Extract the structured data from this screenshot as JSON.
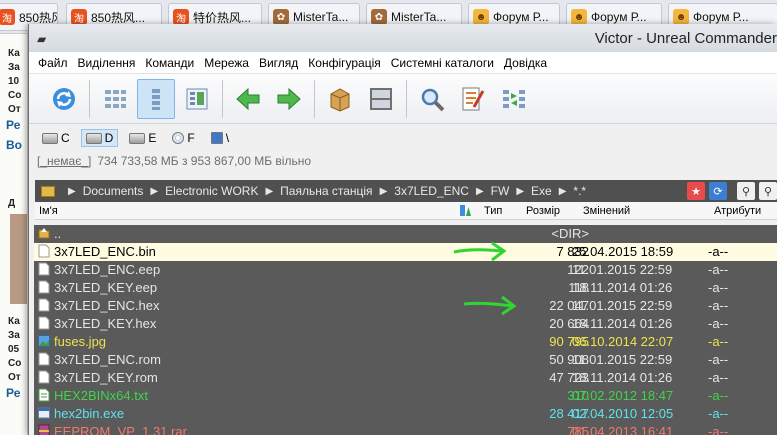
{
  "browser_tabs": [
    {
      "label": "850热风...",
      "icon": "taobao-icon"
    },
    {
      "label": "850热风...",
      "icon": "taobao-icon"
    },
    {
      "label": "特价热风...",
      "icon": "taobao-icon"
    },
    {
      "label": "MisterTa...",
      "icon": "paw-icon"
    },
    {
      "label": "MisterTa...",
      "icon": "paw-icon"
    },
    {
      "label": "Форум Р...",
      "icon": "cat-icon"
    },
    {
      "label": "Форум Р...",
      "icon": "cat-icon"
    },
    {
      "label": "Форум Р...",
      "icon": "cat-icon"
    }
  ],
  "background_page": {
    "fragments": [
      "Ка",
      "За",
      "10",
      "Со",
      "От",
      "Ре",
      "Во",
      "Д",
      "Ка",
      "За",
      "05",
      "Со",
      "От",
      "Ре"
    ]
  },
  "window": {
    "title": "Victor - Unreal Commander"
  },
  "menu": [
    "Файл",
    "Виділення",
    "Команди",
    "Мережа",
    "Вигляд",
    "Конфігурація",
    "Системні каталоги",
    "Довідка"
  ],
  "toolbar": [
    {
      "name": "refresh-icon"
    },
    {
      "name": "brief-view-icon"
    },
    {
      "name": "detailed-view-icon",
      "active": true
    },
    {
      "name": "thumbnails-icon"
    },
    {
      "name": "back-arrow-icon"
    },
    {
      "name": "forward-arrow-icon"
    },
    {
      "name": "archive-icon"
    },
    {
      "name": "network-icon"
    },
    {
      "name": "search-icon"
    },
    {
      "name": "multi-rename-icon"
    },
    {
      "name": "sync-dirs-icon"
    }
  ],
  "drives": [
    {
      "letter": "C",
      "type": "hdd"
    },
    {
      "letter": "D",
      "type": "hdd",
      "active": true
    },
    {
      "letter": "E",
      "type": "hdd"
    },
    {
      "letter": "F",
      "type": "cd"
    },
    {
      "letter": "\\",
      "type": "net"
    }
  ],
  "free_space": {
    "label": "[_немає_]",
    "text": "734 733,58 МБ  з  953 867,00 МБ  вільно"
  },
  "path": {
    "crumbs": [
      "Documents",
      "Electronic WORK",
      "Паяльна станція",
      "3x7LED_ENC",
      "FW",
      "Exe",
      "*.*"
    ]
  },
  "columns": {
    "name": "Ім'я",
    "type": "Тип",
    "size": "Розмір",
    "modified": "Змінений",
    "attributes": "Атрибути"
  },
  "files": [
    {
      "name": "..",
      "size": "<DIR>",
      "date": "",
      "attr": "",
      "color": "#e6e6e6",
      "icon": "up-folder"
    },
    {
      "name": "3x7LED_ENC.bin",
      "size": "7 832",
      "date": "25.04.2015 18:59",
      "attr": "-a--",
      "color": "#000000",
      "icon": "file",
      "cursor": true
    },
    {
      "name": "3x7LED_ENC.eep",
      "size": "122",
      "date": "11.01.2015 22:59",
      "attr": "-a--",
      "color": "#e6e6e6",
      "icon": "file"
    },
    {
      "name": "3x7LED_KEY.eep",
      "size": "118",
      "date": "18.11.2014 01:26",
      "attr": "-a--",
      "color": "#e6e6e6",
      "icon": "file"
    },
    {
      "name": "3x7LED_ENC.hex",
      "size": "22 047",
      "date": "11.01.2015 22:59",
      "attr": "-a--",
      "color": "#e6e6e6",
      "icon": "file"
    },
    {
      "name": "3x7LED_KEY.hex",
      "size": "20 664",
      "date": "18.11.2014 01:26",
      "attr": "-a--",
      "color": "#e6e6e6",
      "icon": "file"
    },
    {
      "name": "fuses.jpg",
      "size": "90 795",
      "date": "06.10.2014 22:07",
      "attr": "-a--",
      "color": "#ece54a",
      "icon": "image"
    },
    {
      "name": "3x7LED_ENC.rom",
      "size": "50 908",
      "date": "11.01.2015 22:59",
      "attr": "-a--",
      "color": "#e6e6e6",
      "icon": "file"
    },
    {
      "name": "3x7LED_KEY.rom",
      "size": "47 723",
      "date": "18.11.2014 01:26",
      "attr": "-a--",
      "color": "#e6e6e6",
      "icon": "file"
    },
    {
      "name": "HEX2BINx64.txt",
      "size": "310",
      "date": "07.02.2012 18:47",
      "attr": "-a--",
      "color": "#41d34b",
      "icon": "text"
    },
    {
      "name": "hex2bin.exe",
      "size": "28 417",
      "date": "02.04.2010 12:05",
      "attr": "-a--",
      "color": "#5de3ee",
      "icon": "exe"
    },
    {
      "name": "EEPROM_VP_1.31.rar",
      "size": "785",
      "date": "01.04.2013 16:41",
      "attr": "-a--",
      "color": "#f07a6e",
      "icon": "rar"
    }
  ],
  "colors": {
    "panel_bg": "#5a5a5a",
    "cursor_bg": "#fffbe0",
    "annotation_arrow": "#2fd62f",
    "path_bg": "#505050"
  }
}
